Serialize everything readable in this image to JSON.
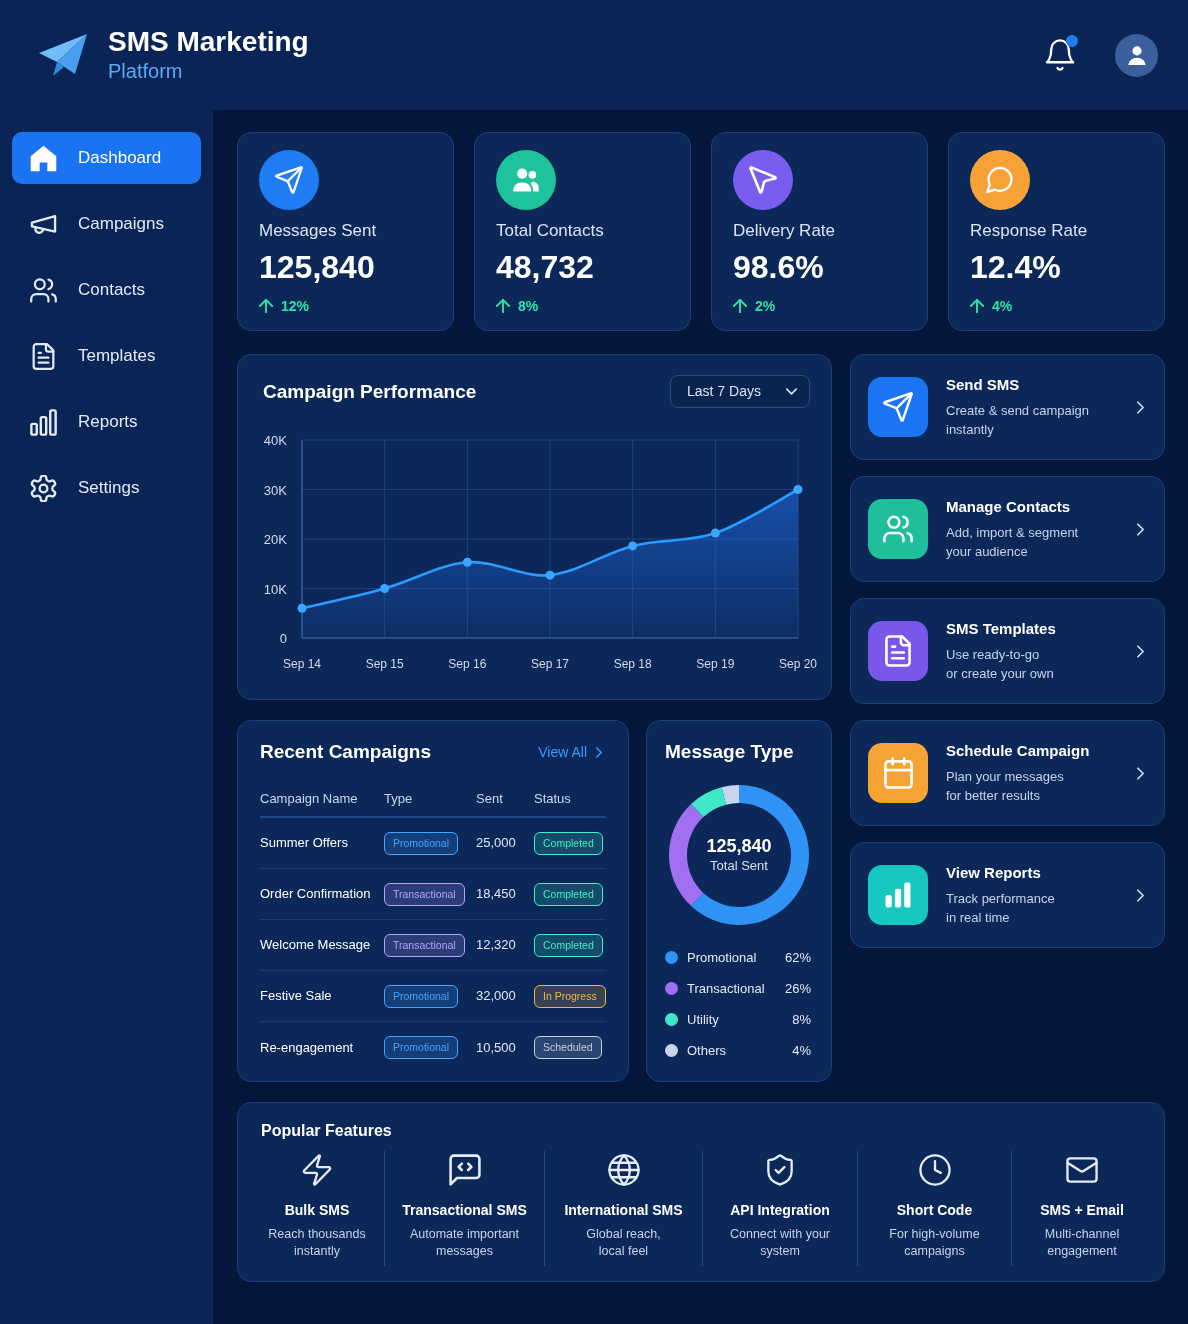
{
  "header": {
    "title": "SMS Marketing",
    "subtitle": "Platform",
    "notifications_unread": true
  },
  "sidebar": {
    "items": [
      {
        "label": "Dashboard",
        "selected": true
      },
      {
        "label": "Campaigns",
        "selected": false
      },
      {
        "label": "Contacts",
        "selected": false
      },
      {
        "label": "Templates",
        "selected": false
      },
      {
        "label": "Reports",
        "selected": false
      },
      {
        "label": "Settings",
        "selected": false
      }
    ]
  },
  "stats": [
    {
      "label": "Messages Sent",
      "value": "125,840",
      "change": "12%",
      "color": "#1f7cf2"
    },
    {
      "label": "Total Contacts",
      "value": "48,732",
      "change": "8%",
      "color": "#1ec29c"
    },
    {
      "label": "Delivery Rate",
      "value": "98.6%",
      "change": "2%",
      "color": "#7a5cf0"
    },
    {
      "label": "Response Rate",
      "value": "12.4%",
      "change": "4%",
      "color": "#f7a236"
    }
  ],
  "performance": {
    "title": "Campaign Performance",
    "range": "Last 7 Days",
    "chart_data": {
      "type": "area",
      "grid": true,
      "categories": [
        "Sep 14",
        "Sep 15",
        "Sep 16",
        "Sep 17",
        "Sep 18",
        "Sep 19",
        "Sep 20"
      ],
      "values": [
        6000,
        10000,
        15300,
        12700,
        18600,
        21200,
        30000
      ],
      "ylim": [
        0,
        40000
      ],
      "yticks": [
        {
          "value": 0,
          "label": "0"
        },
        {
          "value": 10000,
          "label": "10K"
        },
        {
          "value": 20000,
          "label": "20K"
        },
        {
          "value": 30000,
          "label": "30K"
        },
        {
          "value": 40000,
          "label": "40K"
        }
      ]
    }
  },
  "recent_campaigns": {
    "title": "Recent Campaigns",
    "link": "View All",
    "columns": [
      "Campaign Name",
      "Type",
      "Sent",
      "Status"
    ],
    "rows": [
      {
        "name": "Summer Offers",
        "type": {
          "label": "Promotional",
          "color": "#43a3ff"
        },
        "sent": "25,000",
        "status": {
          "label": "Completed",
          "color": "#3ff0c0"
        }
      },
      {
        "name": "Order Confirmation",
        "type": {
          "label": "Transactional",
          "color": "#b6a3ff"
        },
        "sent": "18,450",
        "status": {
          "label": "Completed",
          "color": "#3ff0c0"
        }
      },
      {
        "name": "Welcome Message",
        "type": {
          "label": "Transactional",
          "color": "#b6a3ff"
        },
        "sent": "12,320",
        "status": {
          "label": "Completed",
          "color": "#3ff0c0"
        }
      },
      {
        "name": "Festive Sale",
        "type": {
          "label": "Promotional",
          "color": "#43a3ff"
        },
        "sent": "32,000",
        "status": {
          "label": "In Progress",
          "color": "#f2b545"
        }
      },
      {
        "name": "Re-engagement",
        "type": {
          "label": "Promotional",
          "color": "#43a3ff"
        },
        "sent": "10,500",
        "status": {
          "label": "Scheduled",
          "color": "#c3cee0"
        }
      }
    ]
  },
  "message_type": {
    "title": "Message Type",
    "total": "125,840",
    "total_label": "Total Sent",
    "chart_data": {
      "type": "donut",
      "categories": [
        "Promotional",
        "Transactional",
        "Utility",
        "Others"
      ],
      "values": [
        62,
        26,
        8,
        4
      ]
    },
    "legend": [
      {
        "value": "62%",
        "color": "#2f93f5"
      },
      {
        "value": "26%",
        "color": "#a06ff2"
      },
      {
        "value": "8%",
        "color": "#3ee8c8"
      },
      {
        "value": "4%",
        "color": "#c7d6ee"
      }
    ]
  },
  "actions": [
    {
      "title": "Send SMS",
      "description": "Create & send campaign\ninstantly",
      "color": "#1b74f2"
    },
    {
      "title": "Manage Contacts",
      "description": "Add, import & segment\nyour audience",
      "color": "#1fbf9c"
    },
    {
      "title": "SMS Templates",
      "description": "Use ready-to-go\nor create your own",
      "color": "#7a56ea"
    },
    {
      "title": "Schedule Campaign",
      "description": "Plan your messages\nfor better results",
      "color": "#f6a335"
    },
    {
      "title": "View Reports",
      "description": "Track performance\nin real time",
      "color": "#16c8c0"
    }
  ],
  "features": {
    "title": "Popular Features",
    "items": [
      {
        "title": "Bulk SMS",
        "description": "Reach thousands\ninstantly"
      },
      {
        "title": "Transactional SMS",
        "description": "Automate important\nmessages"
      },
      {
        "title": "International SMS",
        "description": "Global reach,\nlocal feel"
      },
      {
        "title": "API Integration",
        "description": "Connect with your\nsystem"
      },
      {
        "title": "Short Code",
        "description": "For high-volume\ncampaigns"
      },
      {
        "title": "SMS + Email",
        "description": "Multi-channel\nengagement"
      }
    ]
  }
}
